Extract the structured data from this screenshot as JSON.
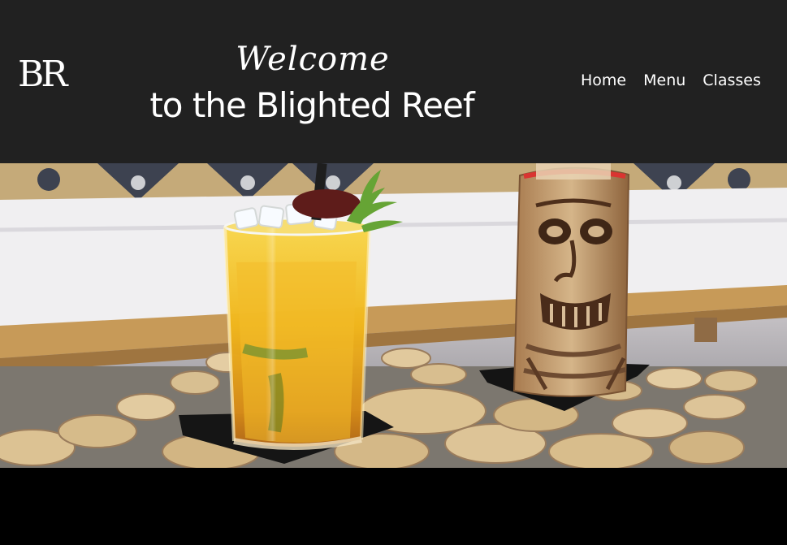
{
  "header": {
    "logo_text": "BR",
    "welcome": "Welcome",
    "title": "to the Blighted Reef"
  },
  "nav": {
    "items": [
      {
        "label": "Home"
      },
      {
        "label": "Menu"
      },
      {
        "label": "Classes"
      }
    ]
  },
  "hero": {
    "subject": "cocktail-and-tiki-mug-photo"
  },
  "colors": {
    "header_bg": "#212121",
    "page_bg": "#000000",
    "text": "#ffffff",
    "drink_color": "#f1b51d",
    "wood_color": "#d1b07e"
  }
}
